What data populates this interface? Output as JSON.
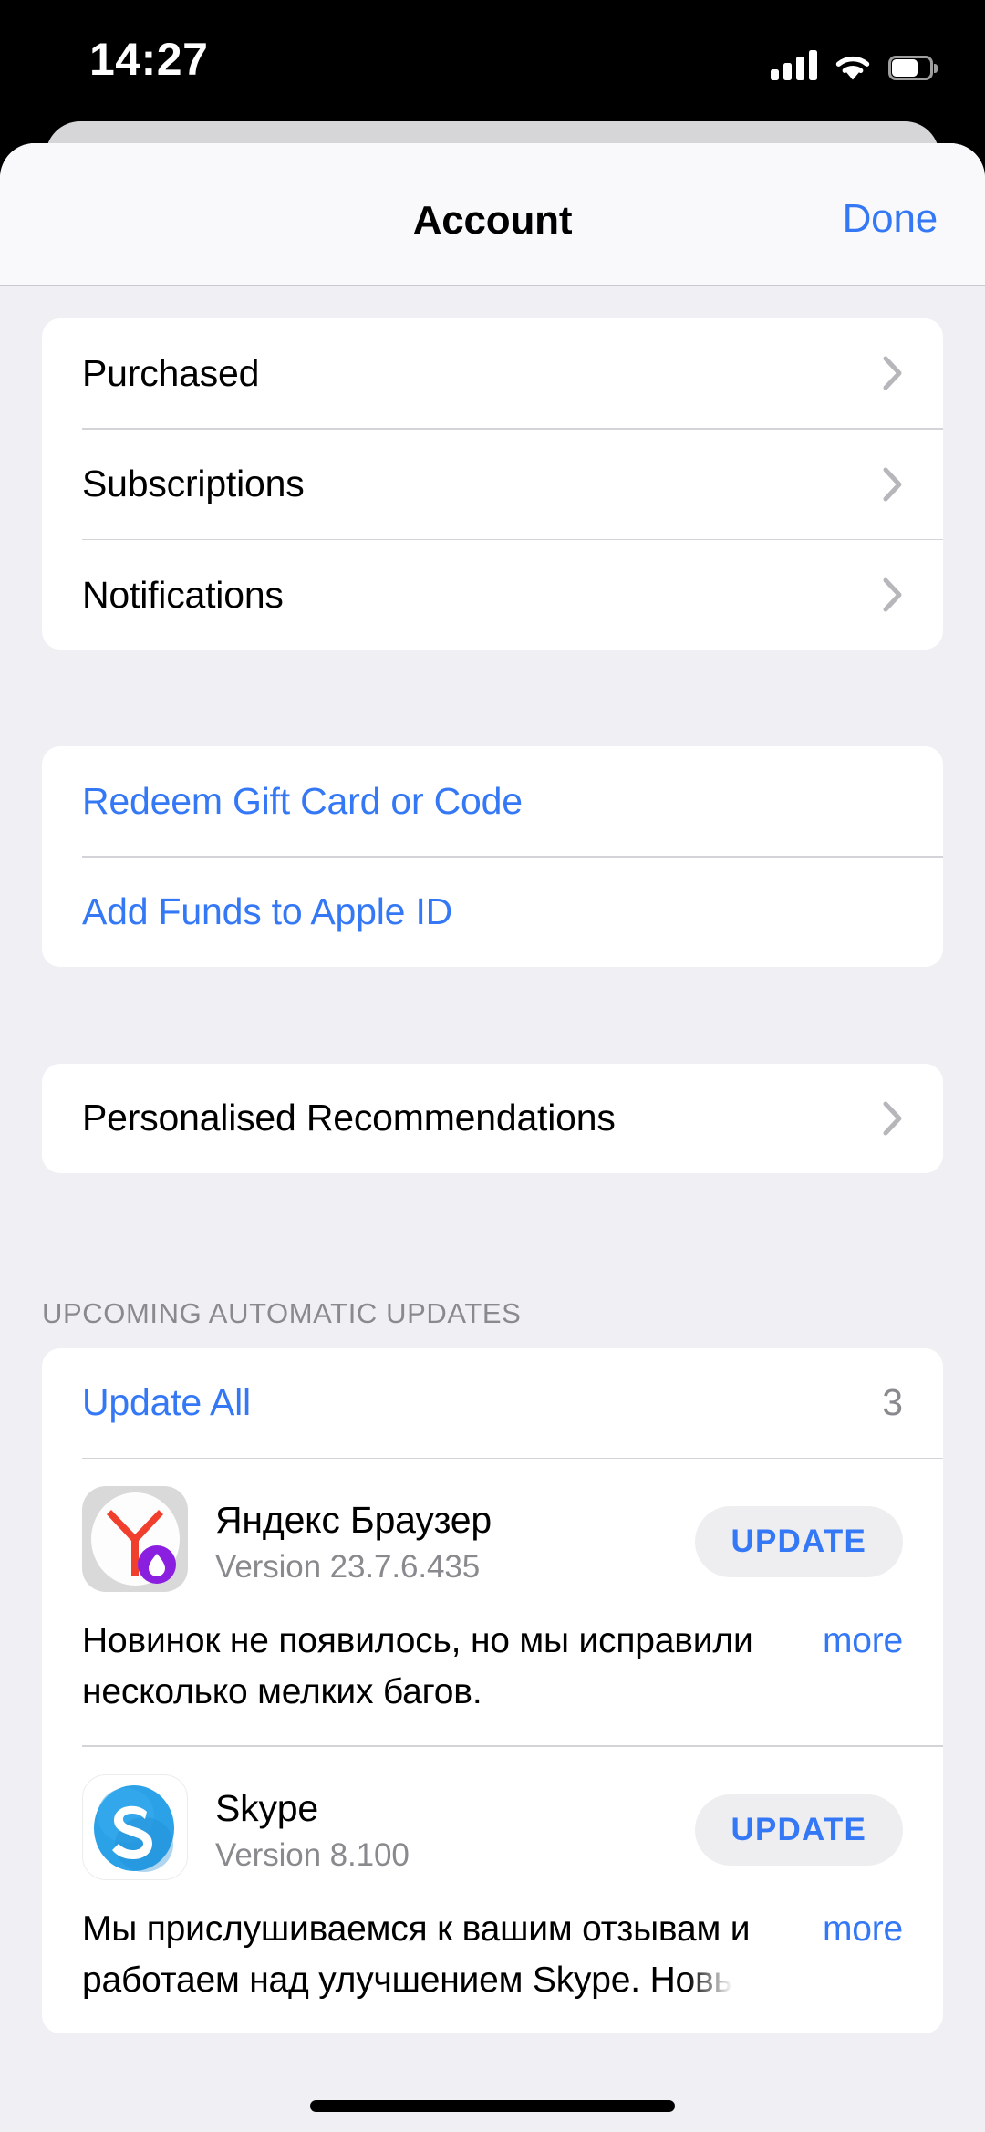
{
  "status_bar": {
    "time": "14:27",
    "signal_icon": "cellular-bars-icon",
    "wifi_icon": "wifi-icon",
    "battery_icon": "battery-icon"
  },
  "header": {
    "title": "Account",
    "done_label": "Done"
  },
  "group_account": {
    "items": [
      {
        "label": "Purchased",
        "accessory": "chevron-right-icon"
      },
      {
        "label": "Subscriptions",
        "accessory": "chevron-right-icon"
      },
      {
        "label": "Notifications",
        "accessory": "chevron-right-icon"
      }
    ]
  },
  "group_funds": {
    "items": [
      {
        "label": "Redeem Gift Card or Code"
      },
      {
        "label": "Add Funds to Apple ID"
      }
    ]
  },
  "group_recommendations": {
    "items": [
      {
        "label": "Personalised Recommendations",
        "accessory": "chevron-right-icon"
      }
    ]
  },
  "updates_section": {
    "header": "UPCOMING AUTOMATIC UPDATES",
    "update_all_label": "Update All",
    "update_all_count": "3",
    "apps": [
      {
        "name": "Яндекс Браузер",
        "version": "Version 23.7.6.435",
        "button_label": "UPDATE",
        "icon": "yandex-browser-icon",
        "notes": "Новинок не появилось, но мы исправили несколько мелких багов.",
        "notes_truncated": "",
        "more_label": "more"
      },
      {
        "name": "Skype",
        "version": "Version 8.100",
        "button_label": "UPDATE",
        "icon": "skype-icon",
        "notes": "Мы прислушиваемся к вашим отзывам и работаем над улучшением Skype.",
        "notes_truncated": "Новь",
        "more_label": "more"
      }
    ]
  },
  "colors": {
    "accent_blue": "#3478f6",
    "secondary_text": "#8a8a8e",
    "group_background": "#efeff4",
    "card_background": "#ffffff"
  }
}
